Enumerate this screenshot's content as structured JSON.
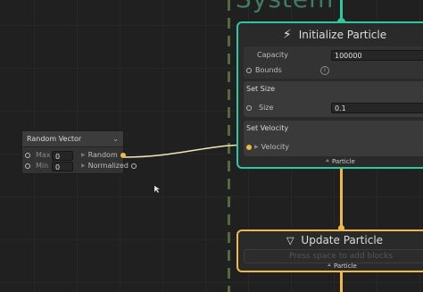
{
  "system": {
    "title": "System"
  },
  "colors": {
    "spawn_flow": "#2ec8a0",
    "particle_flow": "#f0b946",
    "system_dash": "#516b3e",
    "background": "#202020"
  },
  "random_vector": {
    "title": "Random Vector",
    "dropdown_icon": "chevron-down-icon",
    "inputs": [
      {
        "label": "Max",
        "value": "0"
      },
      {
        "label": "Min",
        "value": "0"
      }
    ],
    "outputs": [
      {
        "label": "Random"
      },
      {
        "label": "Normalized"
      }
    ]
  },
  "initialize_context": {
    "icon": "bolt-icon",
    "title": "Initialize Particle",
    "capacity_label": "Capacity",
    "capacity_value": "100000",
    "bounds_label": "Bounds",
    "set_size": {
      "title": "Set Size",
      "field_label": "Size",
      "field_value": "0.1"
    },
    "set_velocity": {
      "title": "Set Velocity",
      "field_label": "Velocity"
    },
    "output_label": "Particle"
  },
  "update_context": {
    "icon": "triangle-down-icon",
    "title": "Update Particle",
    "placeholder": "Press space to add blocks",
    "input_label": "Particle"
  }
}
